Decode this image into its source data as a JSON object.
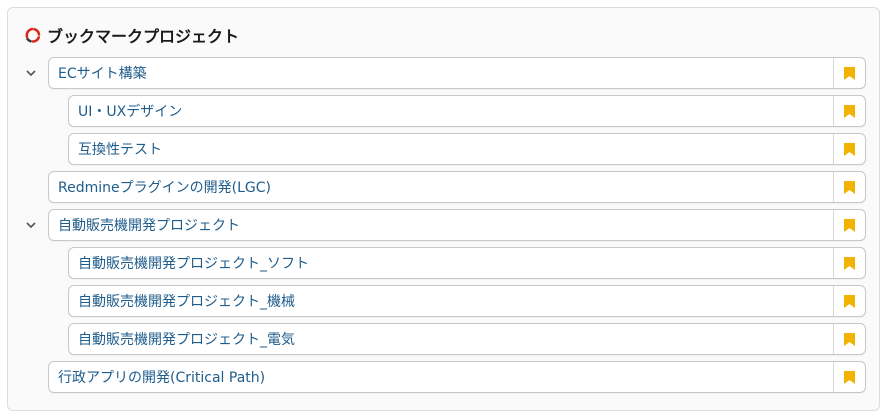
{
  "header": {
    "title": "ブックマークプロジェクト",
    "logo_icon": "redmine-logo-icon"
  },
  "colors": {
    "link": "#1f5d8c",
    "bookmark": "#f0b400",
    "border": "#c8c8c8"
  },
  "projects": [
    {
      "label": "ECサイト構築",
      "level": 0,
      "expanded": true
    },
    {
      "label": "UI・UXデザイン",
      "level": 1
    },
    {
      "label": "互換性テスト",
      "level": 1
    },
    {
      "label": "Redmineプラグインの開発(LGC)",
      "level": 0
    },
    {
      "label": "自動販売機開発プロジェクト",
      "level": 0,
      "expanded": true
    },
    {
      "label": "自動販売機開発プロジェクト_ソフト",
      "level": 1
    },
    {
      "label": "自動販売機開発プロジェクト_機械",
      "level": 1
    },
    {
      "label": "自動販売機開発プロジェクト_電気",
      "level": 1
    },
    {
      "label": "行政アプリの開発(Critical Path)",
      "level": 0
    }
  ],
  "icons": {
    "expander": "chevron-down-icon",
    "bookmark": "bookmark-icon"
  }
}
